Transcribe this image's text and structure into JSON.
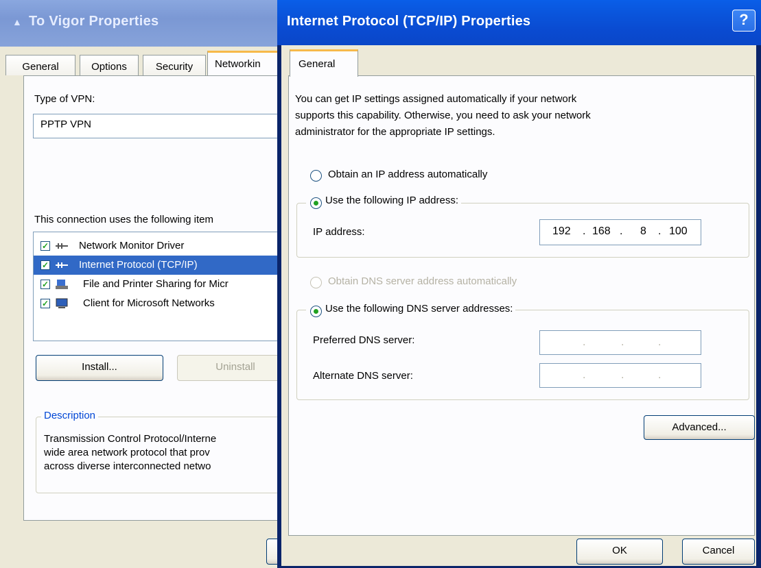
{
  "back_window": {
    "title": "To Vigor Properties",
    "tabs": [
      "General",
      "Options",
      "Security",
      "Networkin"
    ],
    "vpn_type_label": "Type of VPN:",
    "vpn_type_value": "PPTP VPN",
    "items_label": "This connection uses the following item",
    "items": [
      {
        "label": "Network Monitor Driver",
        "checked": true,
        "selected": false,
        "icon": "network-component-icon"
      },
      {
        "label": "Internet Protocol (TCP/IP)",
        "checked": true,
        "selected": true,
        "icon": "network-component-icon"
      },
      {
        "label": "File and Printer Sharing for Micr",
        "checked": true,
        "selected": false,
        "icon": "printer-sharing-icon"
      },
      {
        "label": "Client for Microsoft Networks",
        "checked": true,
        "selected": false,
        "icon": "computer-icon"
      }
    ],
    "install_label": "Install...",
    "uninstall_label": "Uninstall",
    "description_title": "Description",
    "description_lines": [
      "Transmission Control Protocol/Interne",
      "wide area network protocol that prov",
      "across diverse interconnected netwo"
    ]
  },
  "dialog": {
    "title": "Internet Protocol (TCP/IP) Properties",
    "help_label": "?",
    "tab": "General",
    "intro_lines": [
      "You can get IP settings assigned automatically if your network",
      "supports this capability. Otherwise, you need to ask your network",
      "administrator for the appropriate IP settings."
    ],
    "ip_auto_label": "Obtain an IP address automatically",
    "ip_manual_label": "Use the following IP address:",
    "ip_address_label": "IP address:",
    "ip_octets": [
      "192",
      ".",
      "168",
      ".",
      "8",
      ".",
      "100"
    ],
    "dns_auto_label": "Obtain DNS server address automatically",
    "dns_manual_label": "Use the following DNS server addresses:",
    "preferred_dns_label": "Preferred DNS server:",
    "alternate_dns_label": "Alternate DNS server:",
    "dns_dots": [
      ".",
      ".",
      "."
    ],
    "advanced_label": "Advanced...",
    "ok_label": "OK",
    "cancel_label": "Cancel"
  },
  "colors": {
    "dialog_title_bar": "#0a50d8",
    "selection": "#3169c6",
    "tab_highlight": "#f7b94a",
    "window_face": "#ece9d8"
  }
}
